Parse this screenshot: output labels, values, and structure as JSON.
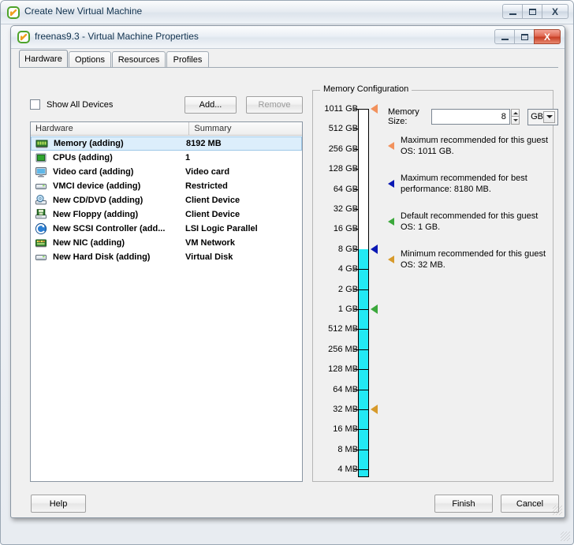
{
  "outer_window": {
    "title": "Create New Virtual Machine",
    "icon": "vmware-icon",
    "controls": {
      "minimize": "–",
      "maximize": "□",
      "close": "X"
    }
  },
  "inner_window": {
    "title": "freenas9.3 - Virtual Machine Properties",
    "icon": "vmware-icon",
    "controls": {
      "minimize": "–",
      "maximize": "□",
      "close": "X"
    }
  },
  "tabs": [
    {
      "label": "Hardware",
      "active": true
    },
    {
      "label": "Options",
      "active": false
    },
    {
      "label": "Resources",
      "active": false
    },
    {
      "label": "Profiles",
      "active": false
    }
  ],
  "toolbar": {
    "show_all_devices_label": "Show All Devices",
    "show_all_devices_checked": false,
    "add_label": "Add...",
    "remove_label": "Remove",
    "remove_disabled": true
  },
  "hardware_table": {
    "columns": [
      "Hardware",
      "Summary"
    ],
    "rows": [
      {
        "icon": "memory-module-icon",
        "name": "Memory (adding)",
        "summary": "8192 MB",
        "selected": true
      },
      {
        "icon": "cpu-chip-icon",
        "name": "CPUs (adding)",
        "summary": "1",
        "selected": false
      },
      {
        "icon": "monitor-icon",
        "name": "Video card  (adding)",
        "summary": "Video card",
        "selected": false
      },
      {
        "icon": "device-card-icon",
        "name": "VMCI device (adding)",
        "summary": "Restricted",
        "selected": false
      },
      {
        "icon": "cd-dvd-drive-icon",
        "name": "New CD/DVD (adding)",
        "summary": "Client Device",
        "selected": false
      },
      {
        "icon": "floppy-drive-icon",
        "name": "New Floppy (adding)",
        "summary": "Client Device",
        "selected": false
      },
      {
        "icon": "scsi-controller-icon",
        "name": "New SCSI Controller (add...",
        "summary": "LSI Logic Parallel",
        "selected": false
      },
      {
        "icon": "network-card-icon",
        "name": "New NIC (adding)",
        "summary": "VM Network",
        "selected": false
      },
      {
        "icon": "hard-disk-icon",
        "name": "New Hard Disk (adding)",
        "summary": "Virtual Disk",
        "selected": false
      }
    ]
  },
  "memory_configuration": {
    "legend": "Memory Configuration",
    "memory_size_label": "Memory Size:",
    "memory_size_value": "8",
    "memory_unit_value": "GB",
    "scale_labels": [
      "1011 GB",
      "512 GB",
      "256 GB",
      "128 GB",
      "64 GB",
      "32 GB",
      "16 GB",
      "8 GB",
      "4 GB",
      "2 GB",
      "1 GB",
      "512 MB",
      "256 MB",
      "128 MB",
      "64 MB",
      "32 MB",
      "16 MB",
      "8 MB",
      "4 MB"
    ],
    "fill_top_label": "8 GB",
    "fill_bottom_label": "4 MB",
    "fill_color": "#22e9f4",
    "markers": [
      {
        "at_label": "1011 GB",
        "color": "#f2915c",
        "name": "max-guest-os-marker"
      },
      {
        "at_label": "8 GB",
        "color": "#0a18b4",
        "name": "best-performance-marker"
      },
      {
        "at_label": "1 GB",
        "color": "#3ba83b",
        "name": "default-recommended-marker"
      },
      {
        "at_label": "32 MB",
        "color": "#d79a2b",
        "name": "minimum-recommended-marker"
      }
    ],
    "recommendations": [
      {
        "color": "#f2915c",
        "text": "Maximum recommended for this guest OS: 1011 GB."
      },
      {
        "color": "#0a18b4",
        "text": "Maximum recommended for best performance: 8180 MB."
      },
      {
        "color": "#3ba83b",
        "text": "Default recommended for this guest OS: 1 GB."
      },
      {
        "color": "#d79a2b",
        "text": "Minimum recommended for this guest OS: 32 MB."
      }
    ]
  },
  "buttons": {
    "help": "Help",
    "finish": "Finish",
    "cancel": "Cancel"
  }
}
